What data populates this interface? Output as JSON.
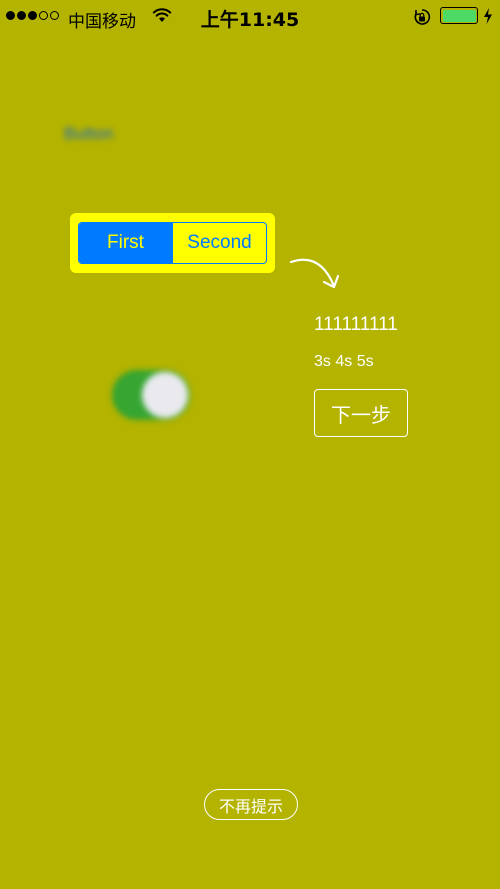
{
  "status_bar": {
    "signal_dots_filled": 3,
    "signal_dots_total": 5,
    "carrier": "中国移动",
    "time": "上午11:45",
    "battery_color": "#4cd964"
  },
  "background": {
    "color": "#b3b300",
    "blurred_button_label": "Button",
    "blurred_switch_on": true
  },
  "segmented_control": {
    "segments": [
      "First",
      "Second"
    ],
    "selected_index": 0,
    "tint_color": "#007aff",
    "highlight_color": "#ffff00"
  },
  "guide": {
    "text": "111111111",
    "subtext": "3s 4s 5s",
    "next_button_label": "下一步",
    "dont_show_again_label": "不再提示"
  },
  "icons": [
    "wifi-icon",
    "rotation-lock-icon",
    "battery-icon",
    "charging-bolt-icon",
    "curved-arrow-icon"
  ]
}
